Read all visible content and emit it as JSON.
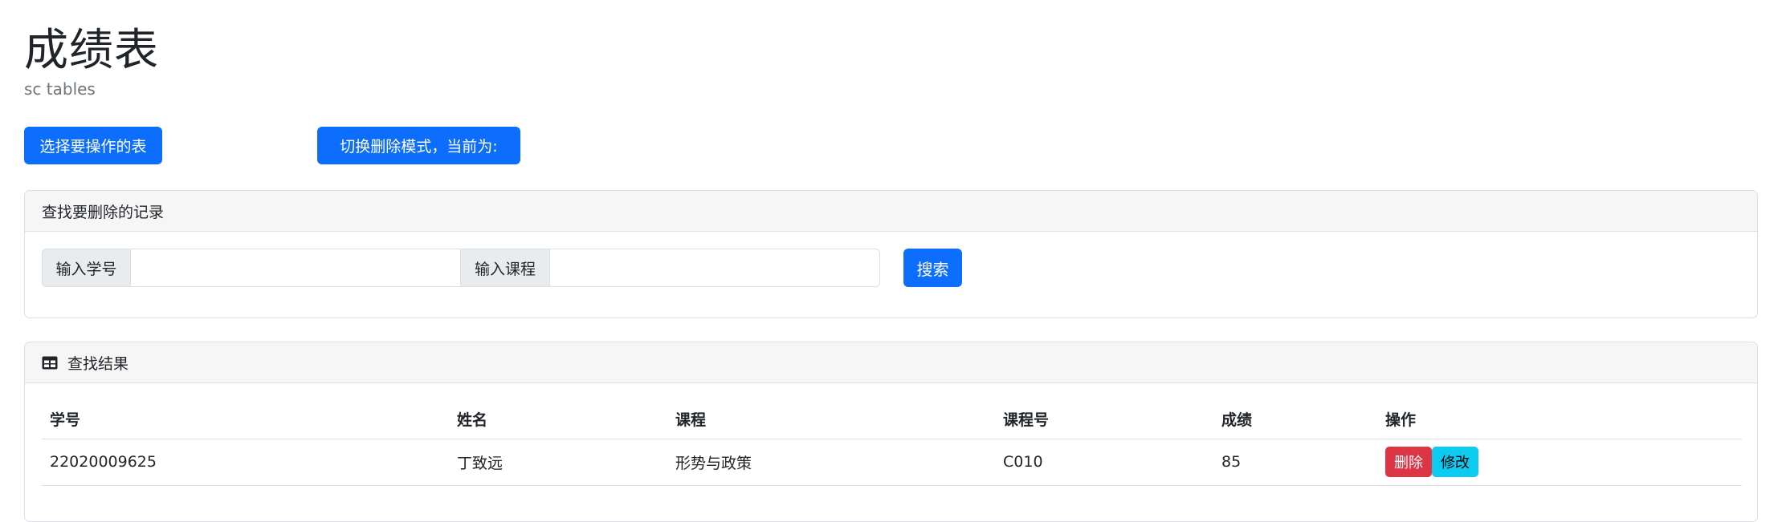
{
  "header": {
    "title": "成绩表",
    "subtitle": "sc tables"
  },
  "actions": {
    "select_table_label": "选择要操作的表",
    "toggle_delete_label": "切换删除模式，当前为:"
  },
  "search_panel": {
    "title": "查找要删除的记录",
    "student_id_label": "输入学号",
    "student_id_value": "",
    "course_label": "输入课程",
    "course_value": "",
    "search_button": "搜索"
  },
  "results_panel": {
    "title": "查找结果",
    "icon": "table-icon",
    "columns": [
      "学号",
      "姓名",
      "课程",
      "课程号",
      "成绩",
      "操作"
    ],
    "rows": [
      {
        "student_id": "22020009625",
        "name": "丁致远",
        "course": "形势与政策",
        "course_no": "C010",
        "score": "85",
        "delete_label": "删除",
        "edit_label": "修改"
      }
    ]
  },
  "colors": {
    "primary": "#0d6efd",
    "danger": "#dc3545",
    "info": "#0dcaf0",
    "header_bg": "#f6f6f6"
  }
}
